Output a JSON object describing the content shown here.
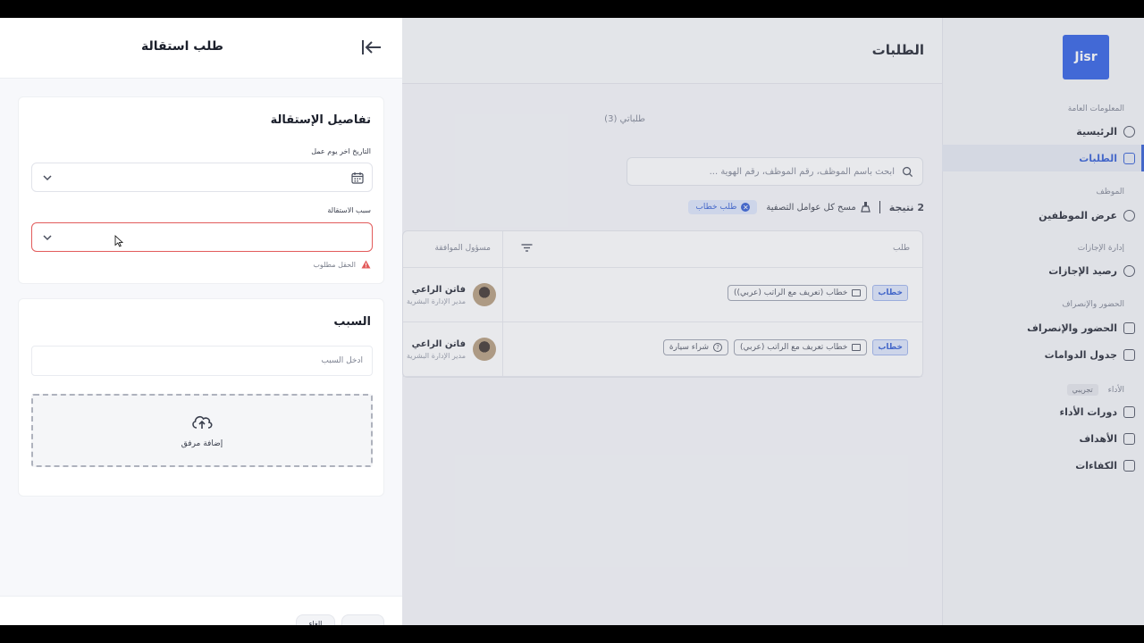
{
  "sidebar": {
    "logo": "Jisr",
    "sections": {
      "general": "المعلومات العامة",
      "employees": "الموظف",
      "leaves": "إدارة الإجازات",
      "attendance": "الحضور والإنصراف",
      "performance": "الأداء",
      "performance_badge": "تجريبي"
    },
    "items": {
      "home": "الرئيسية",
      "requests": "الطلبات",
      "employees_view": "عرض الموظفين",
      "leave_balance": "رصيد الإجازات",
      "attendance": "الحضور والإنصراف",
      "shifts": "جدول الدوامات",
      "review_cycles": "دورات الأداء",
      "goals": "الأهداف",
      "competencies": "الكفاءات"
    }
  },
  "main": {
    "title": "الطلبات",
    "tab_mine": "طلباتي (3)",
    "search_placeholder": "ابحث باسم الموظف، رقم الموظف، رقم الهوية ...",
    "results_count": "2 نتيجة",
    "clear_filters": "مسح كل عوامل التصفية",
    "active_filter": "طلب خطاب",
    "table": {
      "col_request": "طلب",
      "col_owner": "مسؤول الموافقة",
      "rows": [
        {
          "type": "خطاب",
          "pills": [
            "خطاب (تعريف مع الراتب (عربي))"
          ],
          "owner_name": "فاتن الراعي",
          "owner_role": "مدير الإدارة البشرية"
        },
        {
          "type": "خطاب",
          "pills": [
            "خطاب تعريف مع الراتب (عربي)",
            "شراء سيارة"
          ],
          "owner_name": "فاتن الراعي",
          "owner_role": "مدير الإدارة البشرية"
        }
      ]
    }
  },
  "drawer": {
    "title": "طلب استقالة",
    "details_card": {
      "title": "تفاصيل الإستقالة",
      "last_day_label": "التاريخ اخر يوم عمل",
      "reason_select_label": "سبب الاستقالة",
      "error_message": "الحقل مطلوب"
    },
    "reason_card": {
      "title": "السبب",
      "reason_placeholder": "ادخل السبب",
      "upload_label": "إضافة مرفق"
    },
    "footer": {
      "cancel_label": "الغاء",
      "submit_label": ""
    }
  },
  "colors": {
    "accent": "#2d59d3",
    "logo_bg": "#2b5be3",
    "error": "#e25b5b"
  }
}
